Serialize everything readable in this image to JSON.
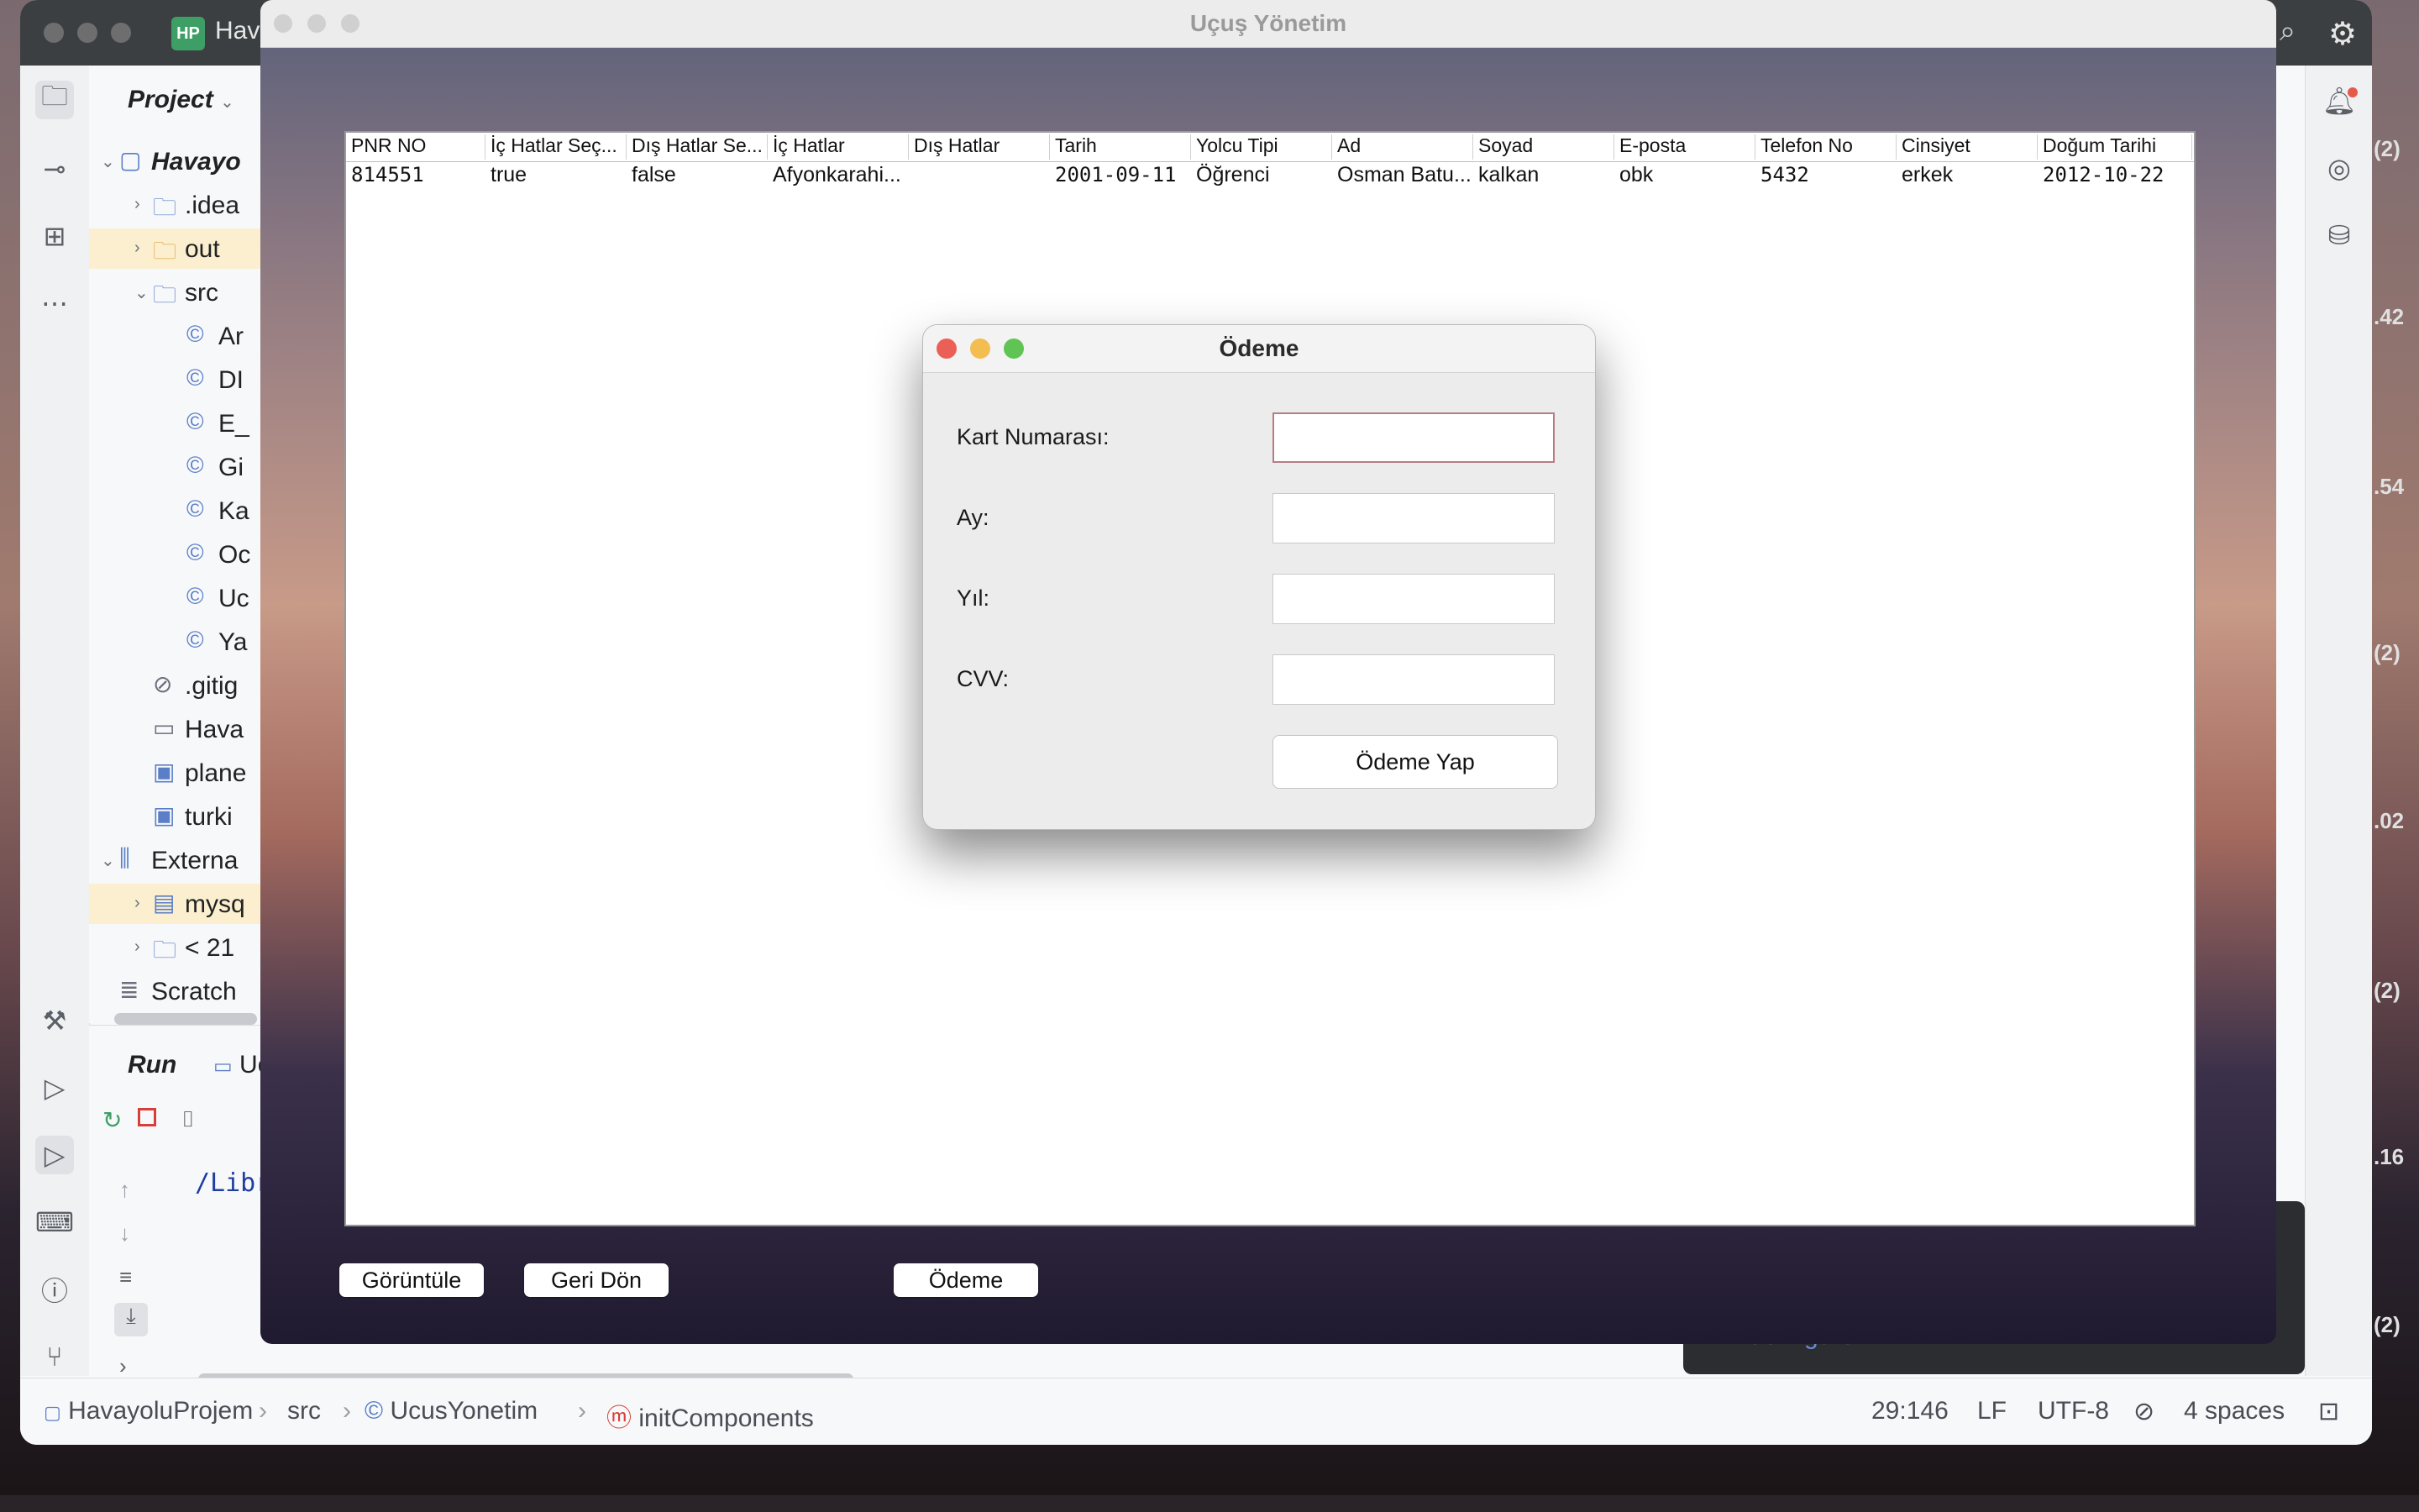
{
  "ide": {
    "title": "Hav",
    "badge": "HP",
    "project_label": "Project",
    "project_chevron": "⌄",
    "tree": [
      {
        "label": "Havayo",
        "icon": "module-icon",
        "chev": "⌄",
        "bold": true
      },
      {
        "label": ".idea",
        "icon": "folder-icon",
        "chev": "›"
      },
      {
        "label": "out",
        "icon": "folder-icon",
        "chev": "›"
      },
      {
        "label": "src",
        "icon": "folder-icon",
        "chev": "⌄"
      },
      {
        "label": "Ar",
        "icon": "class-icon"
      },
      {
        "label": "DI",
        "icon": "class-icon"
      },
      {
        "label": "E_",
        "icon": "class-icon"
      },
      {
        "label": "Gi",
        "icon": "class-icon"
      },
      {
        "label": "Ka",
        "icon": "class-icon"
      },
      {
        "label": "Oc",
        "icon": "class-icon"
      },
      {
        "label": "Uc",
        "icon": "class-icon"
      },
      {
        "label": "Ya",
        "icon": "class-icon"
      },
      {
        "label": ".gitig",
        "icon": "ignore-icon"
      },
      {
        "label": "Hava",
        "icon": "file-icon"
      },
      {
        "label": "plane",
        "icon": "image-icon"
      },
      {
        "label": "turki",
        "icon": "image-icon"
      },
      {
        "label": "Externa",
        "icon": "library-icon",
        "chev": "⌄"
      },
      {
        "label": "mysq",
        "icon": "jar-icon",
        "chev": "›"
      },
      {
        "label": "< 21",
        "icon": "jdk-icon",
        "chev": "›"
      },
      {
        "label": "Scratch",
        "icon": "scratch-icon"
      }
    ],
    "run_label": "Run",
    "run_tab": "Uc",
    "run_path": "/Libra",
    "statusbar": {
      "project": "HavayoluProjem",
      "src": "src",
      "class": "UcusYonetim",
      "method": "initComponents",
      "position": "29:146",
      "line_sep": "LF",
      "encoding": "UTF-8",
      "indent": "4 spaces"
    },
    "edge_numbers": [
      "(2)",
      ".42",
      ".54",
      "(2)",
      ".02",
      "(2)",
      ".16",
      "(2)"
    ],
    "notification_text": "Configure..."
  },
  "swing": {
    "title": "Uçuş Yönetim",
    "columns": [
      "PNR NO",
      "İç Hatlar Seç...",
      "Dış Hatlar Se...",
      "İç Hatlar",
      "Dış Hatlar",
      "Tarih",
      "Yolcu Tipi",
      "Ad",
      "Soyad",
      "E-posta",
      "Telefon No",
      "Cinsiyet",
      "Doğum Tarihi"
    ],
    "rows": [
      [
        "814551",
        "true",
        "false",
        "Afyonkarahi...",
        "",
        "2001-09-11",
        "Öğrenci",
        "Osman Batu...",
        "kalkan",
        "obk",
        "5432",
        "erkek",
        "2012-10-22"
      ]
    ],
    "buttons": {
      "view": "Görüntüle",
      "back": "Geri Dön",
      "pay": "Ödeme"
    }
  },
  "dialog": {
    "title": "Ödeme",
    "card_label": "Kart Numarası:",
    "month_label": "Ay:",
    "year_label": "Yıl:",
    "cvv_label": "CVV:",
    "card_value": "",
    "month_value": "",
    "year_value": "",
    "cvv_value": "",
    "submit": "Ödeme Yap"
  }
}
